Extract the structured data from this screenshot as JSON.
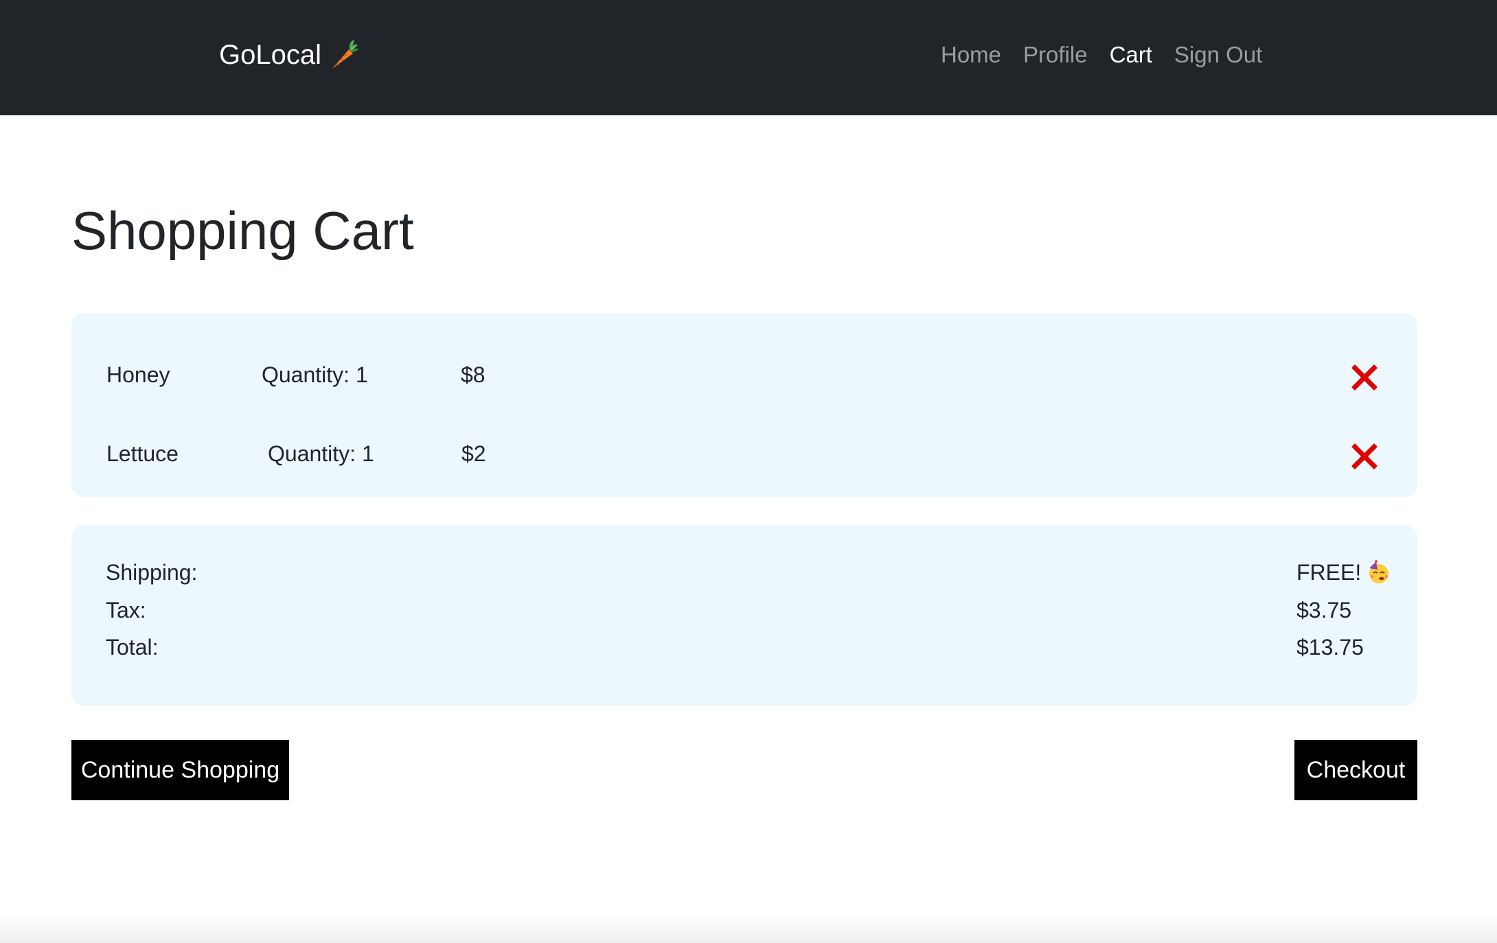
{
  "navbar": {
    "brand": "GoLocal",
    "brand_icon": "carrot-icon",
    "links": [
      {
        "label": "Home",
        "active": false
      },
      {
        "label": "Profile",
        "active": false
      },
      {
        "label": "Cart",
        "active": true
      },
      {
        "label": "Sign Out",
        "active": false
      }
    ],
    "background": "#212529"
  },
  "page": {
    "title": "Shopping Cart"
  },
  "cart": {
    "items": [
      {
        "name": "Honey",
        "quantity": "Quantity: 1",
        "price": "$8",
        "remove_icon": "close-icon"
      },
      {
        "name": "Lettuce",
        "quantity": "Quantity: 1",
        "price": "$2",
        "remove_icon": "close-icon"
      }
    ],
    "panel_color": "#ecf8fc",
    "remove_color": "#e00000"
  },
  "summary": {
    "shipping_label": "Shipping:",
    "shipping_value": "FREE!",
    "shipping_icon": "party-face-icon",
    "tax_label": "Tax:",
    "tax_value": "$3.75",
    "total_label": "Total:",
    "total_value": "$13.75"
  },
  "actions": {
    "continue_label": "Continue Shopping",
    "checkout_label": "Checkout"
  }
}
